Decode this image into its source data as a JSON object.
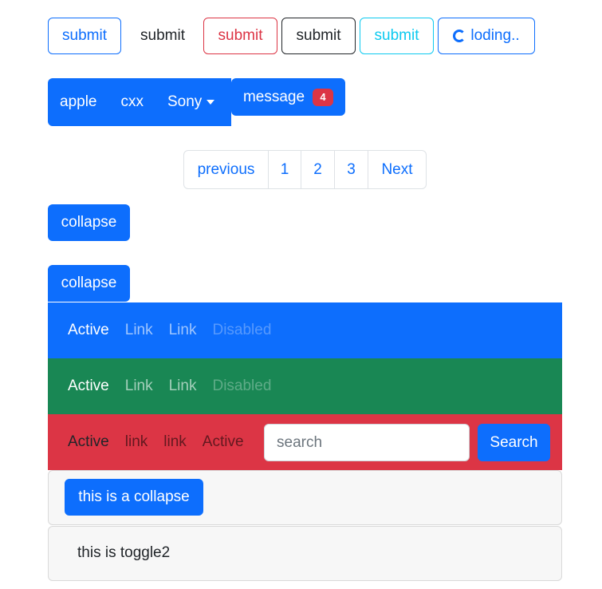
{
  "buttons_row": [
    {
      "label": "submit",
      "style": "outline-primary"
    },
    {
      "label": "submit",
      "style": "link"
    },
    {
      "label": "submit",
      "style": "outline-danger"
    },
    {
      "label": "submit",
      "style": "outline-dark"
    },
    {
      "label": "submit",
      "style": "outline-info"
    }
  ],
  "loading_button": {
    "label": "loding..",
    "icon": "spinner-icon"
  },
  "pills": {
    "items": [
      "apple",
      "cxx"
    ],
    "dropdown_label": "Sony",
    "message_label": "message",
    "message_badge": "4"
  },
  "pagination": {
    "previous": "previous",
    "pages": [
      "1",
      "2",
      "3"
    ],
    "next": "Next"
  },
  "collapse_buttons": [
    "collapse",
    "collapse"
  ],
  "navbars": [
    {
      "bg": "#0d6efd",
      "links": [
        "Active",
        "Link",
        "Link",
        "Disabled"
      ]
    },
    {
      "bg": "#198754",
      "links": [
        "Active",
        "Link",
        "Link",
        "Disabled"
      ]
    },
    {
      "bg": "#dc3545",
      "links": [
        "Active",
        "link",
        "link",
        "Active"
      ],
      "search_placeholder": "search",
      "search_button": "Search"
    }
  ],
  "cards": {
    "collapse_button": "this is a collapse",
    "toggle_text": "this is toggle2"
  },
  "colors": {
    "primary": "#0d6efd",
    "success": "#198754",
    "danger": "#dc3545",
    "info": "#0dcaf0",
    "dark": "#212529"
  }
}
